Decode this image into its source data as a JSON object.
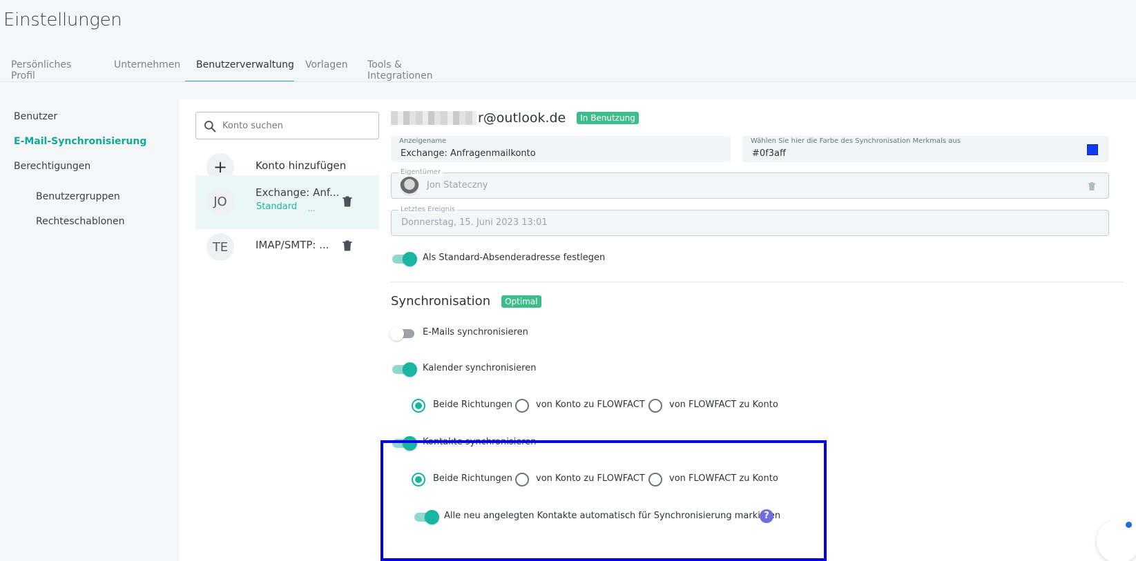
{
  "page": {
    "title": "Einstellungen"
  },
  "topnav": {
    "tabs": [
      {
        "label": "Persönliches Profil"
      },
      {
        "label": "Unternehmen"
      },
      {
        "label": "Benutzerverwaltung",
        "active": true
      },
      {
        "label": "Vorlagen"
      },
      {
        "label": "Tools & Integrationen"
      }
    ]
  },
  "sidebar": {
    "items": [
      {
        "label": "Benutzer"
      },
      {
        "label": "E-Mail-Synchronisierung",
        "active": true
      },
      {
        "label": "Berechtigungen"
      },
      {
        "label": "Benutzergruppen"
      },
      {
        "label": "Rechteschablonen"
      }
    ]
  },
  "accounts": {
    "search_placeholder": "Konto suchen",
    "add_label": "Konto hinzufügen",
    "add_icon": "plus-icon",
    "items": [
      {
        "initials": "JO",
        "name": "Exchange: Anf...",
        "tag": "Standard",
        "dots": "...",
        "selected": true
      },
      {
        "initials": "TE",
        "name": "IMAP/SMTP: ..."
      }
    ]
  },
  "detail": {
    "email_domain": "r@outlook.de",
    "status_chip": "In Benutzung",
    "display_name": {
      "label": "Anzeigename",
      "value": "Exchange: Anfragenmailkonto"
    },
    "color": {
      "label": "Wählen Sie hier die Farbe des Synchronisation Merkmals aus",
      "value": "#0f3aff"
    },
    "owner": {
      "label": "Eigentümer",
      "value": "Jon Stateczny"
    },
    "last_event": {
      "label": "Letztes Ereignis",
      "value": "Donnerstag, 15. Juni 2023 13:01"
    },
    "default_sender": {
      "label": "Als Standard-Absenderadresse festlegen",
      "on": true
    }
  },
  "sync": {
    "title": "Synchronisation",
    "chip": "Optimal",
    "emails": {
      "label": "E-Mails synchronisieren",
      "on": false
    },
    "calendar": {
      "label": "Kalender synchronisieren",
      "on": true,
      "options": [
        "Beide Richtungen",
        "von Konto zu FLOWFACT",
        "von FLOWFACT zu Konto"
      ],
      "selected": 0
    },
    "contacts": {
      "label": "Kontakte synchronisieren",
      "on": true,
      "options": [
        "Beide Richtungen",
        "von Konto zu FLOWFACT",
        "von FLOWFACT zu Konto"
      ],
      "selected": 0
    },
    "auto_mark": {
      "label": "Alle neu angelegten Kontakte automatisch für Synchronisierung markieren",
      "on": true,
      "help": "?"
    }
  },
  "colors": {
    "accent": "#1ab5a3",
    "chip": "#3ebc8a",
    "highlight": "#0000e0",
    "help": "#6f6ddf"
  }
}
